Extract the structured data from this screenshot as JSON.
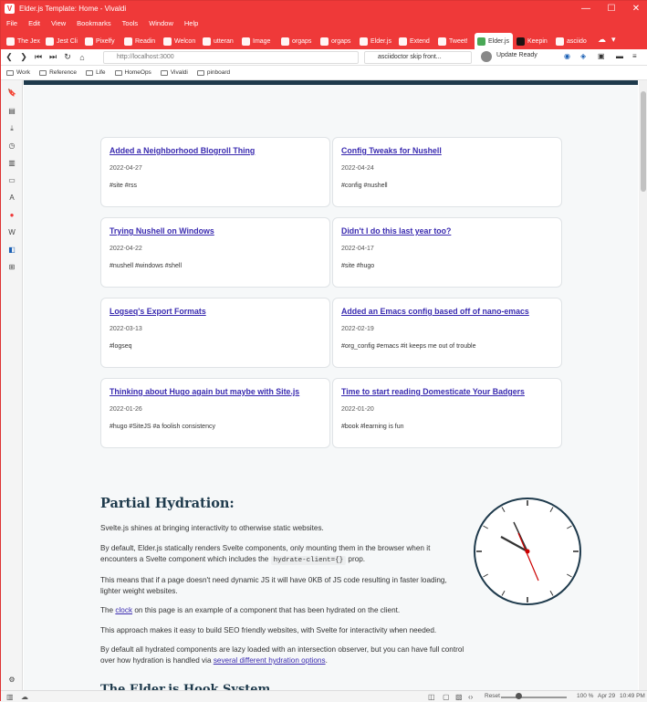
{
  "window": {
    "title": "Elder.js Template: Home - Vivaldi",
    "min": "—",
    "max": "☐",
    "close": "✕"
  },
  "menu": [
    "File",
    "Edit",
    "View",
    "Bookmarks",
    "Tools",
    "Window",
    "Help"
  ],
  "tabs": [
    {
      "label": "The Jex"
    },
    {
      "label": "Jest Cli"
    },
    {
      "label": "Pixelfy"
    },
    {
      "label": "Readin"
    },
    {
      "label": "Welcon"
    },
    {
      "label": "utteran"
    },
    {
      "label": "Image"
    },
    {
      "label": "orgaps"
    },
    {
      "label": "orgaps"
    },
    {
      "label": "Elder.js"
    },
    {
      "label": "Extend"
    },
    {
      "label": "Tweet!"
    },
    {
      "label": "Elder.js"
    },
    {
      "label": "Keepin"
    },
    {
      "label": "asciido"
    }
  ],
  "address": {
    "url": "http://localhost:3000",
    "search": "asciidoctor skip front...",
    "update": "Update Ready"
  },
  "bookmarks": [
    "Work",
    "Reference",
    "Life",
    "HomeOps",
    "Vivaldi",
    "pinboard"
  ],
  "posts": [
    {
      "title": "Added a Neighborhood Blogroll Thing",
      "date": "2022-04-27",
      "tags": "#site  #rss"
    },
    {
      "title": "Config Tweaks for Nushell",
      "date": "2022-04-24",
      "tags": "#config  #nushell"
    },
    {
      "title": "Trying Nushell on Windows",
      "date": "2022-04-22",
      "tags": "#nushell  #windows  #shell"
    },
    {
      "title": "Didn't I do this last year too?",
      "date": "2022-04-17",
      "tags": "#site  #hugo"
    },
    {
      "title": "Logseq's Export Formats",
      "date": "2022-03-13",
      "tags": "#logseq"
    },
    {
      "title": "Added an Emacs config based off of nano-emacs",
      "date": "2022-02-19",
      "tags": "#org_config  #emacs  #it keeps me out of trouble"
    },
    {
      "title": "Thinking about Hugo again but maybe with Site.js",
      "date": "2022-01-26",
      "tags": "#hugo  #SiteJS  #a foolish consistency"
    },
    {
      "title": "Time to start reading Domesticate Your Badgers",
      "date": "2022-01-20",
      "tags": "#book  #learning is fun"
    }
  ],
  "hydration": {
    "heading": "Partial Hydration:",
    "p1": "Svelte.js shines at bringing interactivity to otherwise static websites.",
    "p2a": "By default, Elder.js statically renders Svelte components, only mounting them in the browser when it encounters a Svelte component which includes the",
    "p2code": "hydrate-client={}",
    "p2b": "prop.",
    "p3": "This means that if a page doesn't need dynamic JS it will have 0KB of JS code resulting in faster loading, lighter weight websites.",
    "p4a": "The",
    "p4link": "clock",
    "p4b": "on this page is an example of a component that has been hydrated on the client.",
    "p5": "This approach makes it easy to build SEO friendly websites, with Svelte for interactivity when needed.",
    "p6a": "By default all hydrated components are lazy loaded with an intersection observer, but you can have full control over how hydration is handled via",
    "p6link": "several different hydration options",
    "p6b": ".",
    "next_heading": "The Elder.js Hook System"
  },
  "status": {
    "reset": "Reset",
    "zoom": "100 %",
    "date": "Apr 29",
    "time": "10:49 PM"
  }
}
